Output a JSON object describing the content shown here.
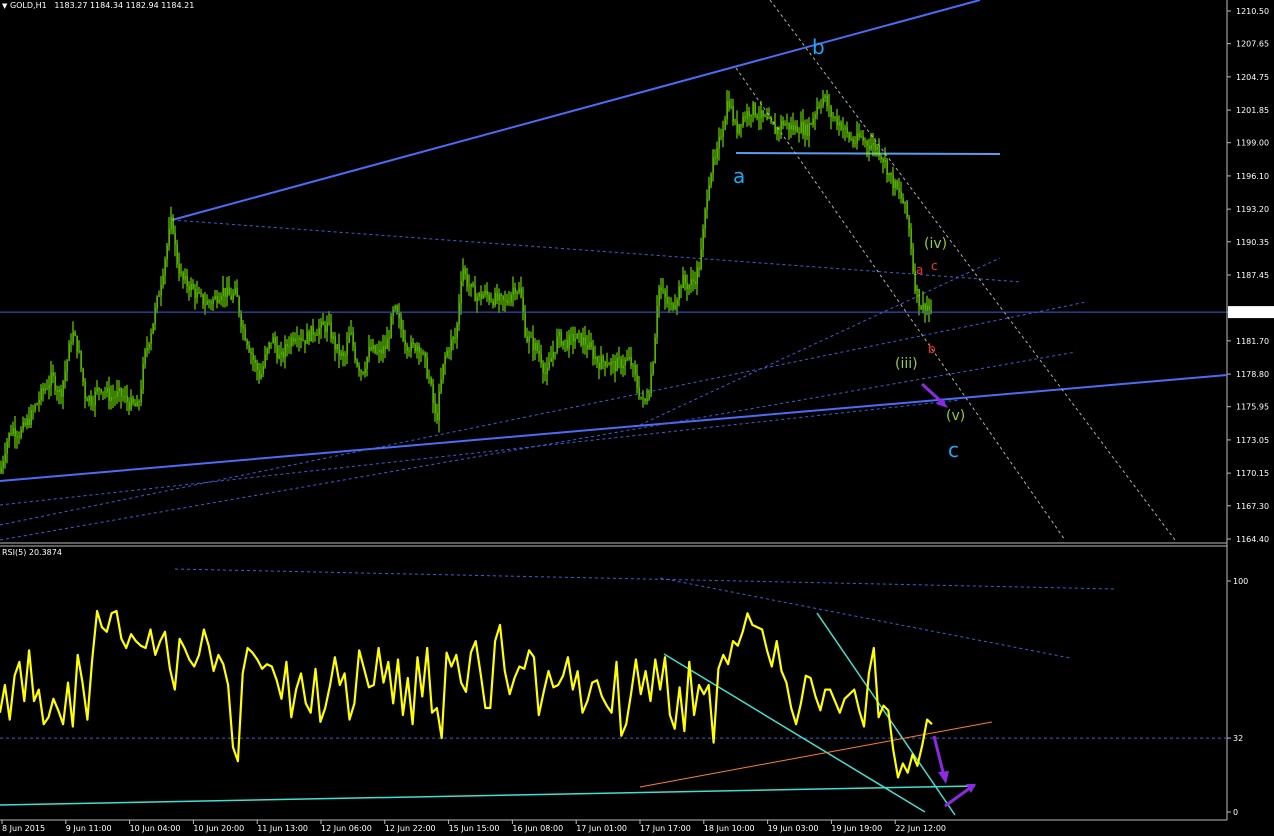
{
  "header": {
    "symbol": "GOLD,H1",
    "ohlc": "1183.27 1184.34 1182.94 1184.21",
    "rsi_label": "RSI(5) 20.3874"
  },
  "colors": {
    "background": "#000000",
    "candles": "#7CFC00",
    "rsi_line": "#FFFF00",
    "trend_solid": "#4A6CF7",
    "trend_dashed": "#3A5FD9",
    "wave_blue": "#1EA7F5",
    "wave_olive": "#9ACD32",
    "wave_red": "#FF3030",
    "arrow": "#8A2BE2",
    "cyan": "#40E0D0",
    "orange": "#FF7F27"
  },
  "chart_data": [
    {
      "type": "candlestick",
      "symbol": "GOLD",
      "timeframe": "H1",
      "last_price": 1184.21,
      "y_ticks": [
        1210.5,
        1207.65,
        1204.75,
        1201.85,
        1199.0,
        1196.1,
        1193.2,
        1190.35,
        1187.45,
        1184.21,
        1181.7,
        1178.8,
        1175.95,
        1173.05,
        1170.15,
        1167.3,
        1164.4
      ],
      "ylim": [
        1164.4,
        1211.2
      ],
      "x_ticks": [
        "8 Jun 2015",
        "9 Jun 11:00",
        "10 Jun 04:00",
        "10 Jun 20:00",
        "11 Jun 13:00",
        "12 Jun 06:00",
        "12 Jun 22:00",
        "15 Jun 15:00",
        "16 Jun 08:00",
        "17 Jun 01:00",
        "17 Jun 17:00",
        "18 Jun 10:00",
        "19 Jun 03:00",
        "19 Jun 19:00",
        "22 Jun 12:00"
      ],
      "close_path": [
        [
          0,
          1170.2
        ],
        [
          6,
          1172.8
        ],
        [
          12,
          1174.1
        ],
        [
          20,
          1173.6
        ],
        [
          30,
          1175.0
        ],
        [
          42,
          1177.2
        ],
        [
          52,
          1178.5
        ],
        [
          60,
          1177.0
        ],
        [
          66,
          1179.5
        ],
        [
          72,
          1182.5
        ],
        [
          78,
          1181.0
        ],
        [
          85,
          1177.0
        ],
        [
          92,
          1176.5
        ],
        [
          100,
          1177.8
        ],
        [
          110,
          1176.8
        ],
        [
          120,
          1177.0
        ],
        [
          130,
          1176.2
        ],
        [
          138,
          1175.8
        ],
        [
          145,
          1180.5
        ],
        [
          152,
          1183.0
        ],
        [
          158,
          1185.5
        ],
        [
          164,
          1188.5
        ],
        [
          168,
          1190.5
        ],
        [
          172,
          1192.5
        ],
        [
          176,
          1189.0
        ],
        [
          182,
          1187.0
        ],
        [
          190,
          1186.5
        ],
        [
          198,
          1185.5
        ],
        [
          206,
          1185.0
        ],
        [
          214,
          1185.3
        ],
        [
          222,
          1186.2
        ],
        [
          230,
          1185.5
        ],
        [
          236,
          1185.8
        ],
        [
          242,
          1183.0
        ],
        [
          248,
          1181.5
        ],
        [
          254,
          1179.8
        ],
        [
          260,
          1178.5
        ],
        [
          266,
          1180.5
        ],
        [
          272,
          1182.0
        ],
        [
          280,
          1180.0
        ],
        [
          288,
          1181.5
        ],
        [
          296,
          1182.5
        ],
        [
          304,
          1181.8
        ],
        [
          312,
          1182.5
        ],
        [
          320,
          1182.8
        ],
        [
          328,
          1183.0
        ],
        [
          336,
          1181.0
        ],
        [
          344,
          1180.0
        ],
        [
          350,
          1182.5
        ],
        [
          356,
          1180.0
        ],
        [
          362,
          1179.0
        ],
        [
          370,
          1181.0
        ],
        [
          378,
          1180.5
        ],
        [
          386,
          1181.2
        ],
        [
          394,
          1184.5
        ],
        [
          400,
          1183.0
        ],
        [
          406,
          1181.5
        ],
        [
          412,
          1181.0
        ],
        [
          418,
          1181.5
        ],
        [
          424,
          1180.0
        ],
        [
          430,
          1178.0
        ],
        [
          436,
          1174.5
        ],
        [
          440,
          1177.5
        ],
        [
          444,
          1180.0
        ],
        [
          450,
          1181.5
        ],
        [
          456,
          1182.0
        ],
        [
          462,
          1188.5
        ],
        [
          466,
          1187.0
        ],
        [
          472,
          1186.0
        ],
        [
          478,
          1185.5
        ],
        [
          484,
          1185.8
        ],
        [
          490,
          1185.5
        ],
        [
          498,
          1185.2
        ],
        [
          506,
          1185.0
        ],
        [
          514,
          1186.5
        ],
        [
          520,
          1186.0
        ],
        [
          526,
          1182.0
        ],
        [
          532,
          1181.5
        ],
        [
          540,
          1180.5
        ],
        [
          546,
          1178.5
        ],
        [
          552,
          1180.5
        ],
        [
          558,
          1182.0
        ],
        [
          566,
          1181.5
        ],
        [
          574,
          1182.0
        ],
        [
          582,
          1181.8
        ],
        [
          590,
          1181.0
        ],
        [
          598,
          1179.8
        ],
        [
          606,
          1180.0
        ],
        [
          614,
          1179.5
        ],
        [
          622,
          1179.8
        ],
        [
          630,
          1180.0
        ],
        [
          638,
          1177.5
        ],
        [
          644,
          1176.0
        ],
        [
          650,
          1178.0
        ],
        [
          654,
          1181.0
        ],
        [
          658,
          1186.5
        ],
        [
          664,
          1185.5
        ],
        [
          670,
          1184.5
        ],
        [
          676,
          1185.5
        ],
        [
          682,
          1187.0
        ],
        [
          688,
          1186.5
        ],
        [
          694,
          1187.0
        ],
        [
          700,
          1188.5
        ],
        [
          704,
          1192.0
        ],
        [
          708,
          1195.5
        ],
        [
          712,
          1197.0
        ],
        [
          716,
          1197.5
        ],
        [
          720,
          1199.5
        ],
        [
          724,
          1201.0
        ],
        [
          728,
          1203.0
        ],
        [
          732,
          1201.5
        ],
        [
          736,
          1200.0
        ],
        [
          740,
          1201.0
        ],
        [
          746,
          1201.5
        ],
        [
          752,
          1202.0
        ],
        [
          758,
          1201.5
        ],
        [
          764,
          1201.0
        ],
        [
          770,
          1200.5
        ],
        [
          776,
          1200.0
        ],
        [
          782,
          1200.8
        ],
        [
          788,
          1200.5
        ],
        [
          794,
          1200.2
        ],
        [
          800,
          1200.5
        ],
        [
          806,
          1200.0
        ],
        [
          812,
          1201.0
        ],
        [
          818,
          1202.5
        ],
        [
          824,
          1203.0
        ],
        [
          830,
          1201.5
        ],
        [
          836,
          1201.0
        ],
        [
          842,
          1200.5
        ],
        [
          848,
          1199.5
        ],
        [
          854,
          1199.0
        ],
        [
          860,
          1199.5
        ],
        [
          866,
          1199.0
        ],
        [
          872,
          1198.8
        ],
        [
          878,
          1198.5
        ],
        [
          884,
          1197.5
        ],
        [
          890,
          1196.0
        ],
        [
          896,
          1195.0
        ],
        [
          902,
          1194.0
        ],
        [
          906,
          1193.0
        ],
        [
          910,
          1191.0
        ],
        [
          914,
          1187.0
        ],
        [
          918,
          1185.5
        ],
        [
          922,
          1184.5
        ],
        [
          926,
          1185.0
        ],
        [
          930,
          1184.2
        ]
      ]
    },
    {
      "type": "line",
      "indicator": "RSI(5)",
      "value": 20.3874,
      "y_ticks": [
        100,
        32,
        0
      ],
      "levels": [
        32
      ],
      "ylim": [
        0,
        100
      ],
      "values": [
        43,
        55,
        40,
        59,
        65,
        48,
        70,
        48,
        53,
        38,
        41,
        49,
        44,
        38,
        56,
        37,
        68,
        56,
        40,
        66,
        87,
        80,
        78,
        86,
        87,
        75,
        71,
        77,
        74,
        72,
        71,
        79,
        68,
        74,
        78,
        62,
        53,
        75,
        71,
        66,
        63,
        68,
        79,
        72,
        61,
        68,
        64,
        55,
        28,
        22,
        60,
        71,
        69,
        66,
        62,
        64,
        63,
        57,
        49,
        65,
        41,
        53,
        60,
        47,
        43,
        62,
        39,
        45,
        55,
        67,
        55,
        60,
        40,
        47,
        70,
        62,
        54,
        55,
        71,
        56,
        65,
        47,
        66,
        42,
        58,
        38,
        67,
        50,
        71,
        43,
        45,
        32,
        69,
        63,
        68,
        56,
        52,
        69,
        74,
        60,
        45,
        45,
        74,
        81,
        61,
        51,
        58,
        63,
        62,
        70,
        67,
        42,
        52,
        61,
        54,
        55,
        59,
        67,
        53,
        61,
        43,
        48,
        56,
        57,
        50,
        46,
        43,
        65,
        33,
        38,
        51,
        66,
        51,
        61,
        48,
        66,
        53,
        67,
        42,
        36,
        54,
        35,
        65,
        42,
        55,
        51,
        55,
        30,
        62,
        68,
        64,
        74,
        72,
        78,
        86,
        81,
        80,
        79,
        70,
        63,
        74,
        61,
        56,
        45,
        38,
        47,
        59,
        58,
        50,
        44,
        53,
        53,
        48,
        43,
        49,
        51,
        53,
        44,
        37,
        60,
        71,
        41,
        46,
        44,
        27,
        15,
        21,
        17,
        25,
        20,
        29,
        40,
        38
      ]
    }
  ],
  "annotations": {
    "wave_a": "a",
    "wave_b": "b",
    "wave_c": "c",
    "wave_iii": "(iii)",
    "wave_iv": "(iv)",
    "wave_v": "(v)",
    "sub_a": "a",
    "sub_b": "b",
    "sub_c": "c"
  }
}
